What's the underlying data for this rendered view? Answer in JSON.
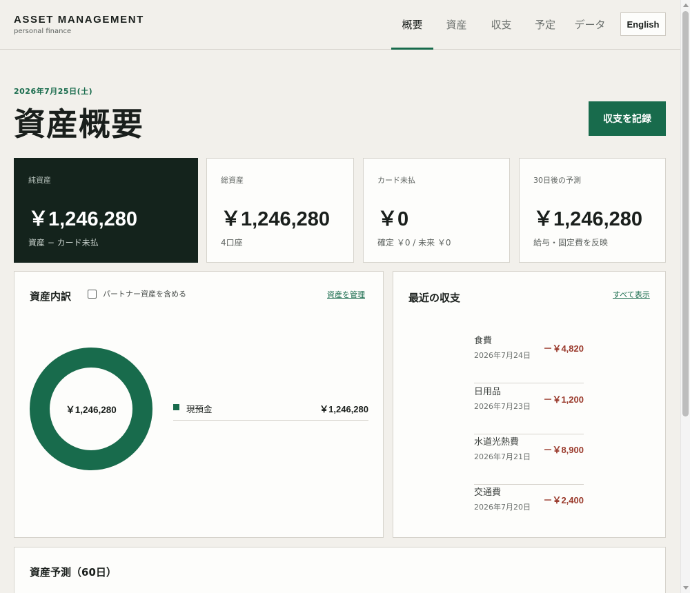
{
  "brand": {
    "title": "ASSET MANAGEMENT",
    "subtitle": "personal finance"
  },
  "nav": {
    "items": [
      {
        "label": "概要",
        "active": true
      },
      {
        "label": "資産",
        "active": false
      },
      {
        "label": "収支",
        "active": false
      },
      {
        "label": "予定",
        "active": false
      },
      {
        "label": "データ",
        "active": false
      }
    ],
    "language_button": "English"
  },
  "page": {
    "date": "2026年7月25日(土)",
    "title": "資産概要",
    "record_button": "収支を記録"
  },
  "kpis": [
    {
      "label": "純資産",
      "value": "￥1,246,280",
      "sub": "資産 − カード未払"
    },
    {
      "label": "総資産",
      "value": "￥1,246,280",
      "sub": "4口座"
    },
    {
      "label": "カード未払",
      "value": "￥0",
      "sub": "確定 ￥0 / 未来 ￥0"
    },
    {
      "label": "30日後の予測",
      "value": "￥1,246,280",
      "sub": "給与・固定費を反映"
    }
  ],
  "breakdown": {
    "title": "資産内訳",
    "include_partner_label": "パートナー資産を含める",
    "include_partner_checked": false,
    "manage_link": "資産を管理",
    "donut_center": "￥1,246,280",
    "items": [
      {
        "name": "現預金",
        "value": "￥1,246,280",
        "share": 1.0,
        "color": "#186b4c"
      }
    ]
  },
  "recent": {
    "title": "最近の収支",
    "view_all_link": "すべて表示",
    "transactions": [
      {
        "category": "食費",
        "date": "2026年7月24日",
        "amount": "－￥4,820"
      },
      {
        "category": "日用品",
        "date": "2026年7月23日",
        "amount": "－￥1,200"
      },
      {
        "category": "水道光熱費",
        "date": "2026年7月21日",
        "amount": "－￥8,900"
      },
      {
        "category": "交通費",
        "date": "2026年7月20日",
        "amount": "－￥2,400"
      }
    ]
  },
  "forecast": {
    "title": "資産予測（60日）"
  },
  "colors": {
    "accent": "#186b4c",
    "dark_card": "#14231c",
    "negative": "#9a3a2c",
    "background": "#f2f0eb"
  }
}
